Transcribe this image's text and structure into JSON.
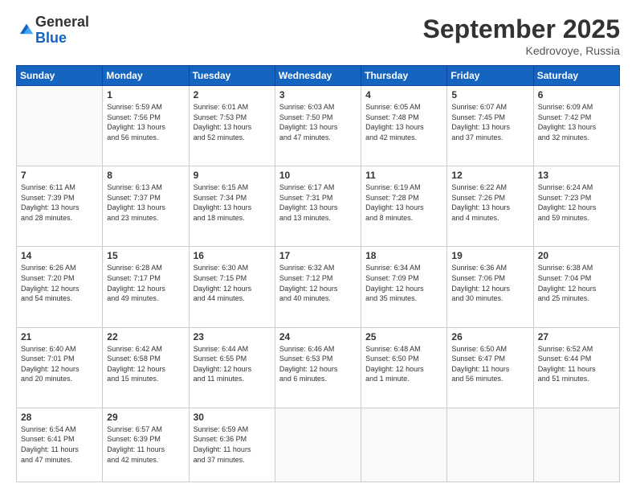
{
  "header": {
    "logo_general": "General",
    "logo_blue": "Blue",
    "month": "September 2025",
    "location": "Kedrovoye, Russia"
  },
  "weekdays": [
    "Sunday",
    "Monday",
    "Tuesday",
    "Wednesday",
    "Thursday",
    "Friday",
    "Saturday"
  ],
  "weeks": [
    [
      {
        "day": "",
        "info": ""
      },
      {
        "day": "1",
        "info": "Sunrise: 5:59 AM\nSunset: 7:56 PM\nDaylight: 13 hours\nand 56 minutes."
      },
      {
        "day": "2",
        "info": "Sunrise: 6:01 AM\nSunset: 7:53 PM\nDaylight: 13 hours\nand 52 minutes."
      },
      {
        "day": "3",
        "info": "Sunrise: 6:03 AM\nSunset: 7:50 PM\nDaylight: 13 hours\nand 47 minutes."
      },
      {
        "day": "4",
        "info": "Sunrise: 6:05 AM\nSunset: 7:48 PM\nDaylight: 13 hours\nand 42 minutes."
      },
      {
        "day": "5",
        "info": "Sunrise: 6:07 AM\nSunset: 7:45 PM\nDaylight: 13 hours\nand 37 minutes."
      },
      {
        "day": "6",
        "info": "Sunrise: 6:09 AM\nSunset: 7:42 PM\nDaylight: 13 hours\nand 32 minutes."
      }
    ],
    [
      {
        "day": "7",
        "info": "Sunrise: 6:11 AM\nSunset: 7:39 PM\nDaylight: 13 hours\nand 28 minutes."
      },
      {
        "day": "8",
        "info": "Sunrise: 6:13 AM\nSunset: 7:37 PM\nDaylight: 13 hours\nand 23 minutes."
      },
      {
        "day": "9",
        "info": "Sunrise: 6:15 AM\nSunset: 7:34 PM\nDaylight: 13 hours\nand 18 minutes."
      },
      {
        "day": "10",
        "info": "Sunrise: 6:17 AM\nSunset: 7:31 PM\nDaylight: 13 hours\nand 13 minutes."
      },
      {
        "day": "11",
        "info": "Sunrise: 6:19 AM\nSunset: 7:28 PM\nDaylight: 13 hours\nand 8 minutes."
      },
      {
        "day": "12",
        "info": "Sunrise: 6:22 AM\nSunset: 7:26 PM\nDaylight: 13 hours\nand 4 minutes."
      },
      {
        "day": "13",
        "info": "Sunrise: 6:24 AM\nSunset: 7:23 PM\nDaylight: 12 hours\nand 59 minutes."
      }
    ],
    [
      {
        "day": "14",
        "info": "Sunrise: 6:26 AM\nSunset: 7:20 PM\nDaylight: 12 hours\nand 54 minutes."
      },
      {
        "day": "15",
        "info": "Sunrise: 6:28 AM\nSunset: 7:17 PM\nDaylight: 12 hours\nand 49 minutes."
      },
      {
        "day": "16",
        "info": "Sunrise: 6:30 AM\nSunset: 7:15 PM\nDaylight: 12 hours\nand 44 minutes."
      },
      {
        "day": "17",
        "info": "Sunrise: 6:32 AM\nSunset: 7:12 PM\nDaylight: 12 hours\nand 40 minutes."
      },
      {
        "day": "18",
        "info": "Sunrise: 6:34 AM\nSunset: 7:09 PM\nDaylight: 12 hours\nand 35 minutes."
      },
      {
        "day": "19",
        "info": "Sunrise: 6:36 AM\nSunset: 7:06 PM\nDaylight: 12 hours\nand 30 minutes."
      },
      {
        "day": "20",
        "info": "Sunrise: 6:38 AM\nSunset: 7:04 PM\nDaylight: 12 hours\nand 25 minutes."
      }
    ],
    [
      {
        "day": "21",
        "info": "Sunrise: 6:40 AM\nSunset: 7:01 PM\nDaylight: 12 hours\nand 20 minutes."
      },
      {
        "day": "22",
        "info": "Sunrise: 6:42 AM\nSunset: 6:58 PM\nDaylight: 12 hours\nand 15 minutes."
      },
      {
        "day": "23",
        "info": "Sunrise: 6:44 AM\nSunset: 6:55 PM\nDaylight: 12 hours\nand 11 minutes."
      },
      {
        "day": "24",
        "info": "Sunrise: 6:46 AM\nSunset: 6:53 PM\nDaylight: 12 hours\nand 6 minutes."
      },
      {
        "day": "25",
        "info": "Sunrise: 6:48 AM\nSunset: 6:50 PM\nDaylight: 12 hours\nand 1 minute."
      },
      {
        "day": "26",
        "info": "Sunrise: 6:50 AM\nSunset: 6:47 PM\nDaylight: 11 hours\nand 56 minutes."
      },
      {
        "day": "27",
        "info": "Sunrise: 6:52 AM\nSunset: 6:44 PM\nDaylight: 11 hours\nand 51 minutes."
      }
    ],
    [
      {
        "day": "28",
        "info": "Sunrise: 6:54 AM\nSunset: 6:41 PM\nDaylight: 11 hours\nand 47 minutes."
      },
      {
        "day": "29",
        "info": "Sunrise: 6:57 AM\nSunset: 6:39 PM\nDaylight: 11 hours\nand 42 minutes."
      },
      {
        "day": "30",
        "info": "Sunrise: 6:59 AM\nSunset: 6:36 PM\nDaylight: 11 hours\nand 37 minutes."
      },
      {
        "day": "",
        "info": ""
      },
      {
        "day": "",
        "info": ""
      },
      {
        "day": "",
        "info": ""
      },
      {
        "day": "",
        "info": ""
      }
    ]
  ]
}
